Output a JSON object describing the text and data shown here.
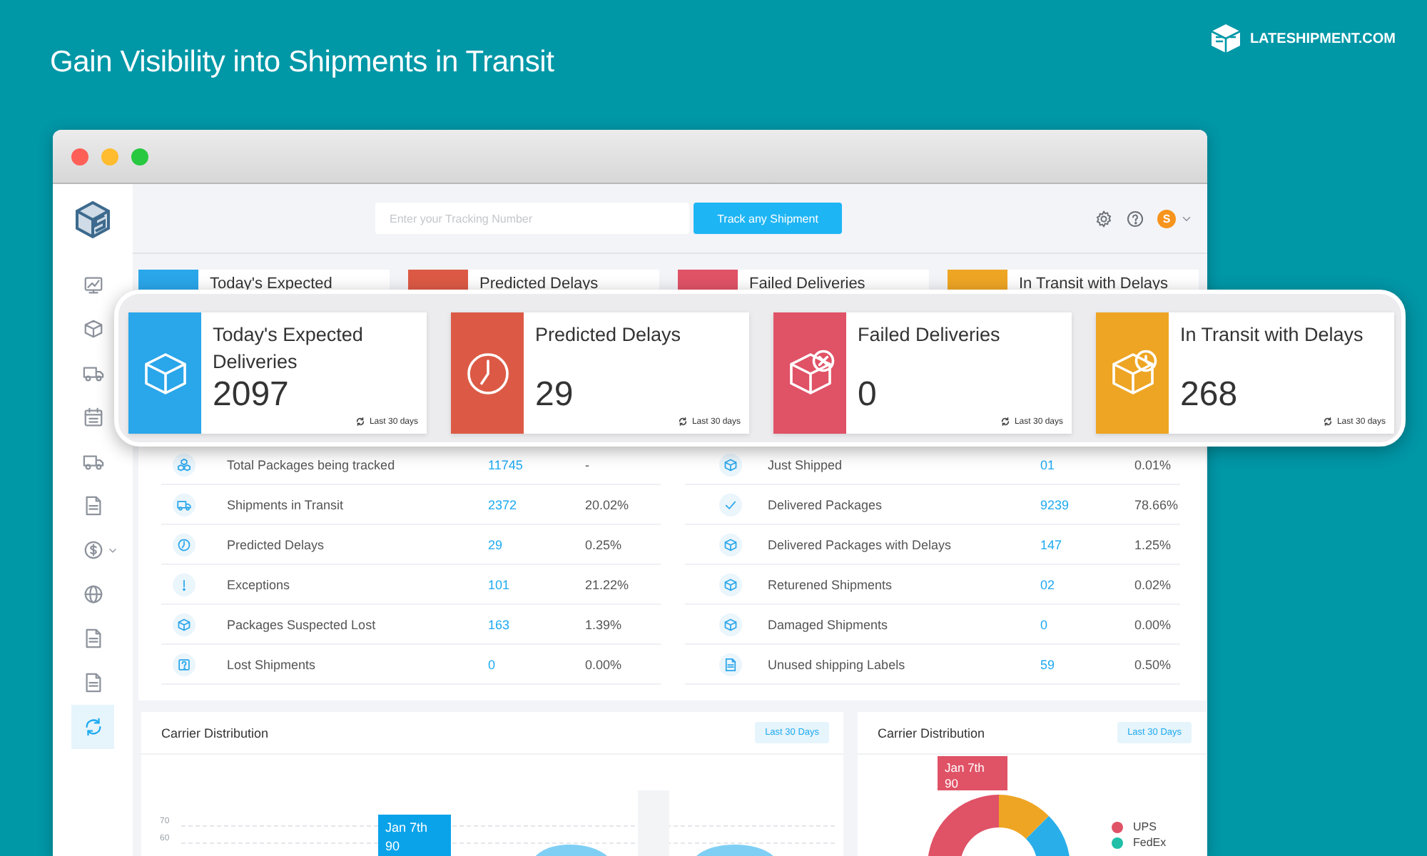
{
  "headline": "Gain Visibility into Shipments in Transit",
  "brand": "LATESHIPMENT.COM",
  "topbar": {
    "search": {
      "placeholder": "Enter your Tracking Number"
    },
    "track_button": "Track any Shipment",
    "avatar": "S"
  },
  "sidebar": {
    "items": [
      {
        "kind": "chart",
        "selected": false,
        "expandable": false
      },
      {
        "kind": "box",
        "selected": false,
        "expandable": false
      },
      {
        "kind": "truck",
        "selected": false,
        "expandable": false
      },
      {
        "kind": "calendar",
        "selected": false,
        "expandable": false
      },
      {
        "kind": "truck",
        "selected": false,
        "expandable": false
      },
      {
        "kind": "document",
        "selected": false,
        "expandable": false
      },
      {
        "kind": "coin",
        "selected": false,
        "expandable": true
      },
      {
        "kind": "globe",
        "selected": false,
        "expandable": false
      },
      {
        "kind": "document",
        "selected": false,
        "expandable": false
      },
      {
        "kind": "document",
        "selected": false,
        "expandable": false
      },
      {
        "kind": "refresh",
        "selected": true,
        "expandable": false
      }
    ]
  },
  "background_cards": [
    {
      "title": "Today's Expected",
      "color": "#2aa6ea"
    },
    {
      "title": "Predicted Delays",
      "color": "#dc5a45"
    },
    {
      "title": "Failed Deliveries",
      "color": "#e05266"
    },
    {
      "title": "In Transit with Delays",
      "color": "#eea524"
    }
  ],
  "summary_cards": [
    {
      "kind": "box",
      "title": "Today's Expected Deliveries",
      "value": "2097",
      "period": "Last 30 days",
      "color": "#2aa6ea"
    },
    {
      "kind": "clock",
      "title": "Predicted Delays",
      "value": "29",
      "period": "Last 30 days",
      "color": "#dc5a45"
    },
    {
      "kind": "box-x",
      "title": "Failed Deliveries",
      "value": "0",
      "period": "Last 30 days",
      "color": "#e05266"
    },
    {
      "kind": "box-clock",
      "title": "In Transit with Delays",
      "value": "268",
      "period": "Last 30 days",
      "color": "#eea524"
    }
  ],
  "stats": {
    "left": [
      {
        "kind": "boxes",
        "label": "Total Packages being tracked",
        "count": "11745",
        "share": "-"
      },
      {
        "kind": "truck",
        "label": "Shipments in Transit",
        "count": "2372",
        "share": "20.02%"
      },
      {
        "kind": "clock",
        "label": "Predicted Delays",
        "count": "29",
        "share": "0.25%"
      },
      {
        "kind": "alert",
        "label": "Exceptions",
        "count": "101",
        "share": "21.22%"
      },
      {
        "kind": "box",
        "label": "Packages Suspected Lost",
        "count": "163",
        "share": "1.39%"
      },
      {
        "kind": "question",
        "label": "Lost Shipments",
        "count": "0",
        "share": "0.00%"
      }
    ],
    "right": [
      {
        "kind": "box",
        "label": "Just Shipped",
        "count": "01",
        "share": "0.01%"
      },
      {
        "kind": "check",
        "label": "Delivered Packages",
        "count": "9239",
        "share": "78.66%"
      },
      {
        "kind": "box",
        "label": "Delivered Packages with Delays",
        "count": "147",
        "share": "1.25%"
      },
      {
        "kind": "box",
        "label": "Returened Shipments",
        "count": "02",
        "share": "0.02%"
      },
      {
        "kind": "box",
        "label": "Damaged Shipments",
        "count": "0",
        "share": "0.00%"
      },
      {
        "kind": "document",
        "label": "Unused shipping Labels",
        "count": "59",
        "share": "0.50%"
      }
    ]
  },
  "charts": [
    {
      "kind": "area",
      "title": "Carrier Distribution",
      "period": "Last 30 Days",
      "y_tick_labels": [
        "70",
        "60"
      ],
      "tooltip": {
        "date": "Jan 7th",
        "value": "90"
      }
    },
    {
      "kind": "donut",
      "title": "Carrier Distribution",
      "period": "Last 30 Days",
      "tooltip": {
        "date": "Jan 7th",
        "value": "90"
      },
      "legend": [
        {
          "label": "UPS",
          "color": "#e05266"
        },
        {
          "label": "FedEx",
          "color": "#1fbfa8"
        }
      ]
    }
  ]
}
